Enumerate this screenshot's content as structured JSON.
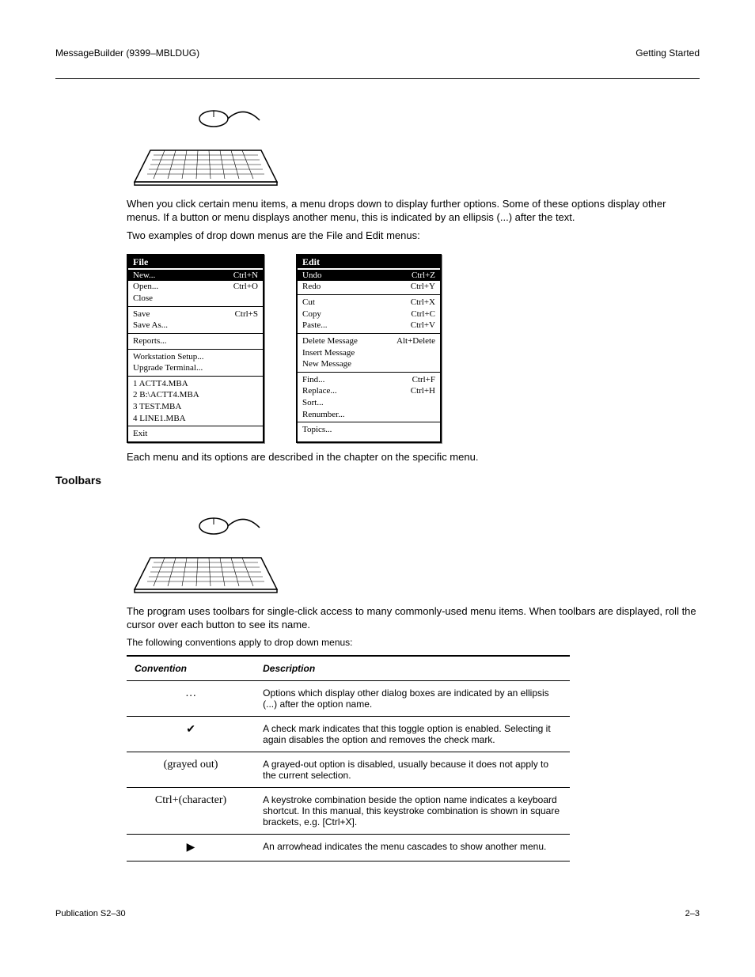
{
  "header": {
    "left": "MessageBuilder (9399–MBLDUG)",
    "right": "Getting Started"
  },
  "intro1": "When you click certain menu items, a menu drops down to display further options. Some of these options display other menus. If a button or menu displays another menu, this is indicated by an ellipsis (...) after the text.",
  "intro2": "Two examples of drop down menus are the File and Edit menus:",
  "menus": {
    "file": {
      "title": "File",
      "groups": [
        [
          {
            "label": "New...",
            "shortcut": "Ctrl+N",
            "highlight": true
          },
          {
            "label": "Open...",
            "shortcut": "Ctrl+O"
          },
          {
            "label": "Close",
            "shortcut": ""
          }
        ],
        [
          {
            "label": "Save",
            "shortcut": "Ctrl+S"
          },
          {
            "label": "Save As...",
            "shortcut": ""
          }
        ],
        [
          {
            "label": "Reports...",
            "shortcut": ""
          }
        ],
        [
          {
            "label": "Workstation Setup...",
            "shortcut": ""
          },
          {
            "label": "Upgrade Terminal...",
            "shortcut": ""
          }
        ],
        [
          {
            "label": "1 ACTT4.MBA",
            "shortcut": ""
          },
          {
            "label": "2 B:\\ACTT4.MBA",
            "shortcut": ""
          },
          {
            "label": "3 TEST.MBA",
            "shortcut": ""
          },
          {
            "label": "4 LINE1.MBA",
            "shortcut": ""
          }
        ],
        [
          {
            "label": "Exit",
            "shortcut": ""
          }
        ]
      ]
    },
    "edit": {
      "title": "Edit",
      "groups": [
        [
          {
            "label": "Undo",
            "shortcut": "Ctrl+Z",
            "highlight": true
          },
          {
            "label": "Redo",
            "shortcut": "Ctrl+Y"
          }
        ],
        [
          {
            "label": "Cut",
            "shortcut": "Ctrl+X"
          },
          {
            "label": "Copy",
            "shortcut": "Ctrl+C"
          },
          {
            "label": "Paste...",
            "shortcut": "Ctrl+V"
          }
        ],
        [
          {
            "label": "Delete Message",
            "shortcut": "Alt+Delete"
          },
          {
            "label": "Insert Message",
            "shortcut": ""
          },
          {
            "label": "New Message",
            "shortcut": ""
          }
        ],
        [
          {
            "label": "Find...",
            "shortcut": "Ctrl+F"
          },
          {
            "label": "Replace...",
            "shortcut": "Ctrl+H"
          },
          {
            "label": "Sort...",
            "shortcut": ""
          },
          {
            "label": "Renumber...",
            "shortcut": ""
          }
        ],
        [
          {
            "label": "Topics...",
            "shortcut": ""
          }
        ]
      ]
    }
  },
  "after_menus": "Each menu and its options are described in the chapter on the specific menu.",
  "toolbars_label": "Toolbars",
  "toolbars_text": "The program uses toolbars for single-click access to many commonly-used menu items. When toolbars are displayed, roll the cursor over each button to see its name.",
  "conventions_title": "The following conventions apply to drop down menus:",
  "conventions": [
    {
      "symbol": "…",
      "desc": "Options which display other dialog boxes are indicated by an ellipsis (...) after the option name."
    },
    {
      "symbol": "✔",
      "desc": "A check mark indicates that this toggle option is enabled. Selecting it again disables the option and removes the check mark."
    },
    {
      "symbol": "(grayed out)",
      "desc": "A grayed-out option is disabled, usually because it does not apply to the current selection."
    },
    {
      "symbol": "Ctrl+(character)",
      "desc": "A keystroke combination beside the option name indicates a keyboard shortcut. In this manual, this keystroke combination is shown in square brackets, e.g. [Ctrl+X]."
    },
    {
      "symbol": "▶",
      "desc": "An arrowhead indicates the menu cascades to show another menu."
    }
  ],
  "footer": {
    "page": "2–3",
    "pub": "Publication S2–30"
  }
}
